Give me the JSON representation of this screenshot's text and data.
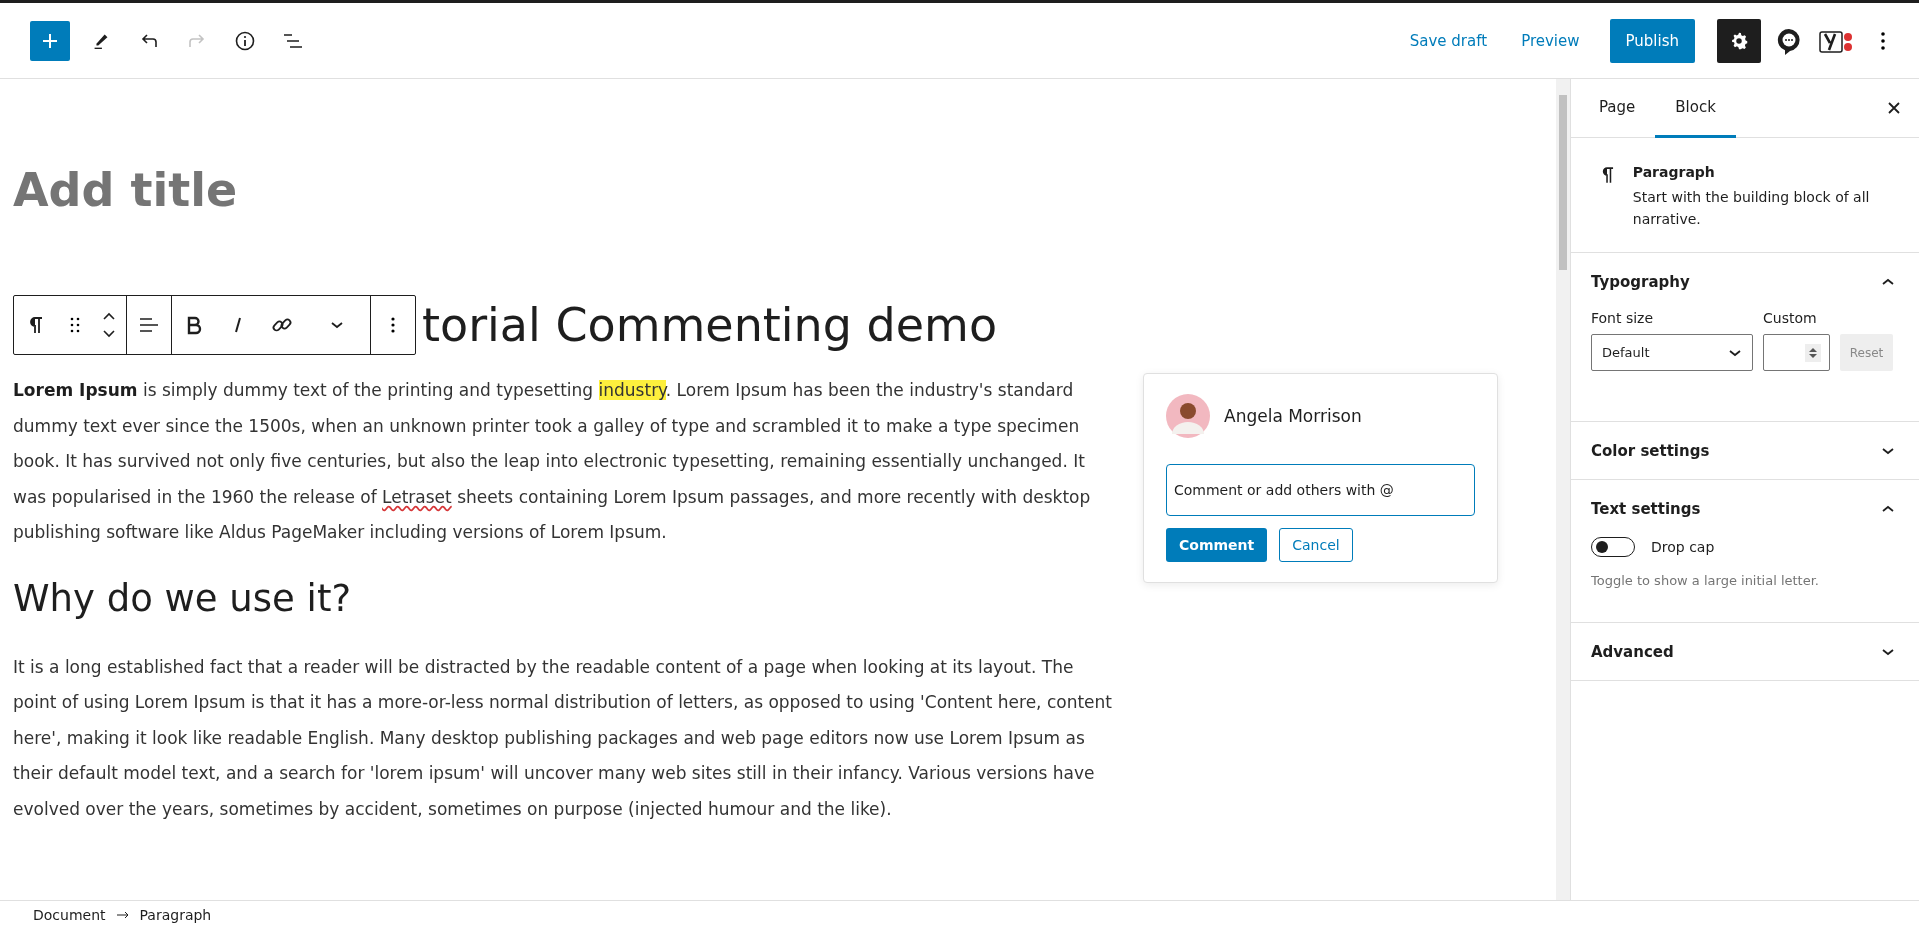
{
  "top_bar": {
    "tools": [
      {
        "kind": "add"
      },
      {
        "kind": "edit"
      },
      {
        "kind": "undo",
        "disabled": false
      },
      {
        "kind": "redo",
        "disabled": true
      },
      {
        "kind": "info"
      },
      {
        "kind": "outline"
      }
    ],
    "save_draft": "Save draft",
    "preview": "Preview",
    "publish": "Publish",
    "right_icons": [
      {
        "kind": "settings",
        "selected": true
      },
      {
        "kind": "comments",
        "selected": false
      },
      {
        "kind": "seo",
        "selected": false
      },
      {
        "kind": "more",
        "selected": false
      }
    ]
  },
  "editor": {
    "title_placeholder": "Add title",
    "heading": "torial Commenting demo",
    "block_toolbar": [
      {
        "kind": "paragraph"
      },
      {
        "kind": "drag"
      },
      {
        "kind": "move"
      },
      {
        "kind": "sep"
      },
      {
        "kind": "align"
      },
      {
        "kind": "sep"
      },
      {
        "kind": "bold"
      },
      {
        "kind": "italic"
      },
      {
        "kind": "link"
      },
      {
        "kind": "more-rich"
      },
      {
        "kind": "sep"
      },
      {
        "kind": "options"
      }
    ],
    "blocks": [
      {
        "kind": "paragraph",
        "segments": [
          {
            "kind": "bold",
            "text": "Lorem Ipsum"
          },
          {
            "kind": "plain",
            "text": " is simply dummy text of the printing and typesetting "
          },
          {
            "kind": "highlight",
            "text": "industry"
          },
          {
            "kind": "plain",
            "text": ". Lorem Ipsum has been the industry's standard dummy text ever since the 1500s, when an unknown printer took a galley of type and scrambled it to make a type specimen book. It has survived not only five centuries, but also the leap into electronic typesetting, remaining essentially unchanged. It was popularised in the 1960 the release of "
          },
          {
            "kind": "misspelled",
            "text": "Letraset"
          },
          {
            "kind": "plain",
            "text": " sheets containing Lorem Ipsum passages, and more recently with desktop publishing software like Aldus PageMaker including versions of Lorem Ipsum."
          }
        ]
      },
      {
        "kind": "heading",
        "segments": [
          {
            "kind": "plain",
            "text": "Why do we use it?"
          }
        ]
      },
      {
        "kind": "paragraph",
        "segments": [
          {
            "kind": "plain",
            "text": "It is a long established fact that a reader will be distracted by the readable content of a page when looking at its layout. The point of using Lorem Ipsum is that it has a more-or-less normal distribution of letters, as opposed to using 'Content here, content here', making it look like readable English. Many desktop publishing packages and web page editors now use Lorem Ipsum as their default model text, and a search for 'lorem ipsum' will uncover many web sites still in their infancy. Various versions have evolved over the years, sometimes by accident, sometimes on purpose (injected humour and the like)."
          }
        ]
      }
    ],
    "comment_popup": {
      "author": "Angela Morrison",
      "placeholder": "Comment or add others with @",
      "submit": "Comment",
      "cancel": "Cancel"
    }
  },
  "sidebar": {
    "tabs": [
      {
        "label": "Page",
        "selected": false
      },
      {
        "label": "Block",
        "selected": true
      }
    ],
    "block_card": {
      "title": "Paragraph",
      "description": "Start with the building block of all narrative."
    },
    "panels": [
      {
        "title": "Typography",
        "expanded": true,
        "kind": "typography",
        "font_size_label": "Font size",
        "font_size_value": "Default",
        "custom_label": "Custom",
        "reset": "Reset"
      },
      {
        "title": "Color settings",
        "expanded": false
      },
      {
        "title": "Text settings",
        "expanded": true,
        "kind": "text",
        "toggle_label": "Drop cap",
        "toggle_on": false,
        "help": "Toggle to show a large initial letter."
      },
      {
        "title": "Advanced",
        "expanded": false
      }
    ]
  },
  "breadcrumb": [
    "Document",
    "Paragraph"
  ]
}
